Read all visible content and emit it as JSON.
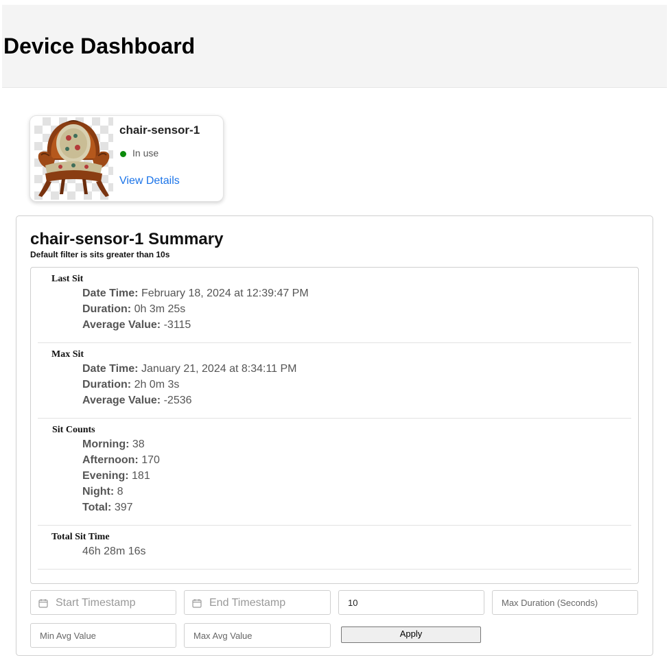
{
  "header": {
    "title": "Device Dashboard"
  },
  "device": {
    "name": "chair-sensor-1",
    "status": "In use",
    "status_color": "#0b8a0b",
    "link": "View Details",
    "image_icon": "armchair-image"
  },
  "summary": {
    "title": "chair-sensor-1 Summary",
    "subtitle": "Default filter is sits greater than 10s",
    "last_sit": {
      "label": "Last Sit",
      "rows": [
        {
          "key": "Date Time:",
          "value": "February 18, 2024 at 12:39:47 PM"
        },
        {
          "key": "Duration:",
          "value": "0h 3m 25s"
        },
        {
          "key": "Average Value:",
          "value": "-3115"
        }
      ]
    },
    "max_sit": {
      "label": "Max Sit",
      "rows": [
        {
          "key": "Date Time:",
          "value": "January 21, 2024 at 8:34:11 PM"
        },
        {
          "key": "Duration:",
          "value": "2h 0m 3s"
        },
        {
          "key": "Average Value:",
          "value": "-2536"
        }
      ]
    },
    "sit_counts": {
      "label": "Sit Counts",
      "rows": [
        {
          "key": "Morning:",
          "value": "38"
        },
        {
          "key": "Afternoon:",
          "value": "170"
        },
        {
          "key": "Evening:",
          "value": "181"
        },
        {
          "key": "Night:",
          "value": "8"
        },
        {
          "key": "Total:",
          "value": "397"
        }
      ]
    },
    "total_sit_time": {
      "label": "Total Sit Time",
      "value": "46h 28m 16s"
    }
  },
  "filters": {
    "start_placeholder": "Start Timestamp",
    "end_placeholder": "End Timestamp",
    "min_duration_value": "10",
    "max_duration_placeholder": "Max Duration (Seconds)",
    "min_avg_placeholder": "Min Avg Value",
    "max_avg_placeholder": "Max Avg Value",
    "apply_label": "Apply"
  }
}
